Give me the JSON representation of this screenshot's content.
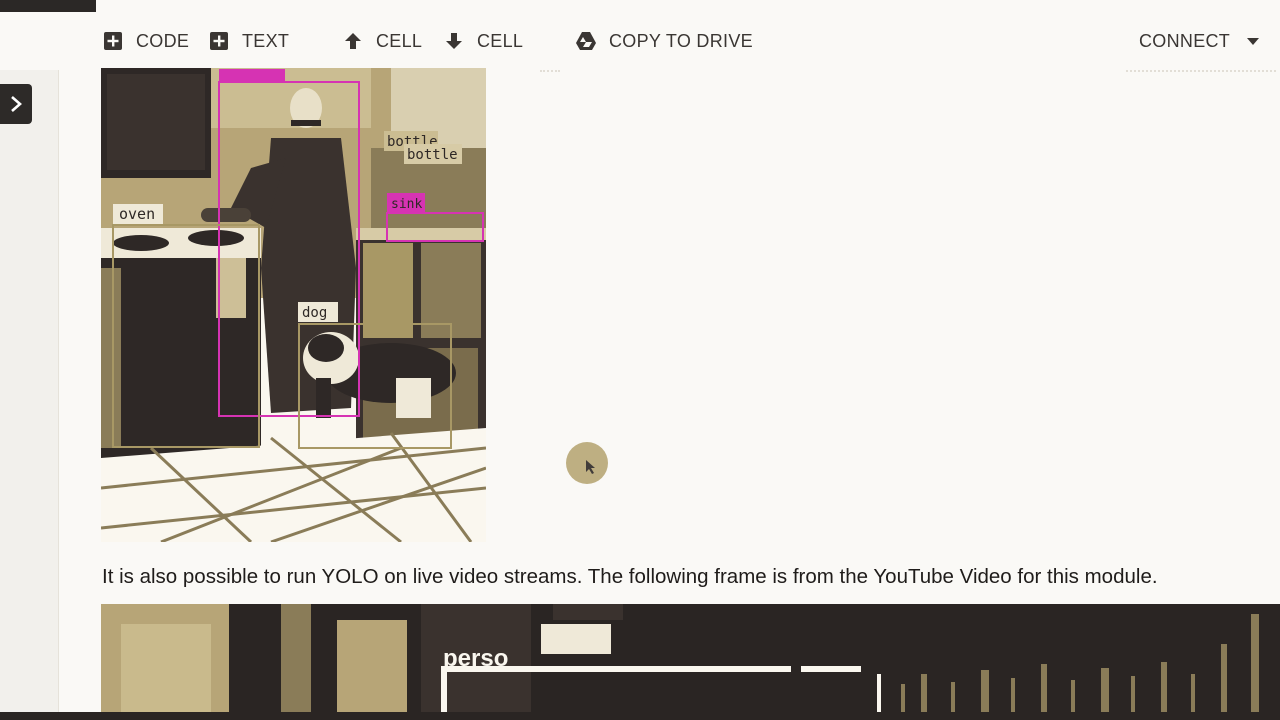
{
  "toolbar": {
    "code_label": "CODE",
    "text_label": "TEXT",
    "cell_up_label": "CELL",
    "cell_down_label": "CELL",
    "copy_drive_label": "COPY TO DRIVE",
    "connect_label": "CONNECT"
  },
  "figure1": {
    "labels": {
      "oven": "oven",
      "bottle1": "bottle",
      "bottle2": "bottle",
      "sink": "sink",
      "dog": "dog"
    }
  },
  "paragraph": "It is also possible to run YOLO on live video streams. The following frame is from the YouTube Video for this module.",
  "figure2": {
    "label": "perso"
  },
  "icons": {
    "code": "add-box-icon",
    "text": "add-box-icon",
    "cell_up": "arrow-up-icon",
    "cell_down": "arrow-down-icon",
    "drive": "drive-icon",
    "connect": "caret-down-icon",
    "sidebar": "chevron-right-icon"
  },
  "colors": {
    "background": "#faf9f6",
    "detection_person": "#d633b3",
    "detection_other": "#a89865",
    "photo_dark": "#2e2826",
    "photo_light": "#b7a577"
  }
}
